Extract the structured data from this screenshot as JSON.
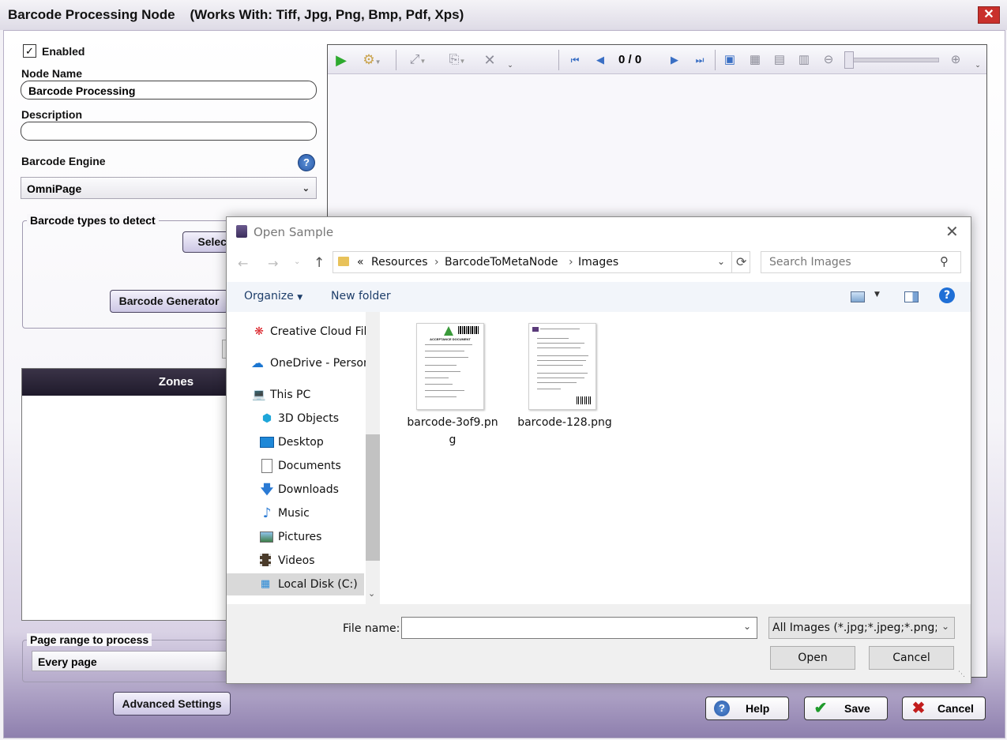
{
  "window": {
    "title": "Barcode Processing Node    (Works With: Tiff, Jpg, Png, Bmp, Pdf, Xps)",
    "close_glyph": "✕"
  },
  "form": {
    "enabled_label": "Enabled",
    "enabled_checked": "✓",
    "node_name_label": "Node Name",
    "node_name_value": "Barcode Processing",
    "description_label": "Description",
    "description_value": "",
    "barcode_engine_label": "Barcode Engine",
    "barcode_engine_value": "OmniPage",
    "barcode_types_label": "Barcode types to detect",
    "select_button": "Select",
    "barcode_generator_button": "Barcode Generator",
    "zones_header": "Zones",
    "page_range_label": "Page range to process",
    "page_range_value": "Every page",
    "advanced_settings_button": "Advanced Settings",
    "help_icon": "?"
  },
  "viewer": {
    "page_current": "0",
    "page_sep": "/",
    "page_total": "0",
    "icons": [
      "play-icon",
      "gear-icon",
      "auto-fit-icon",
      "scanner-icon",
      "delete-icon",
      "first-page-icon",
      "prev-page-icon",
      "next-page-icon",
      "last-page-icon",
      "image-icon",
      "fit-page-icon",
      "fit-width-icon",
      "fit-height-icon",
      "zoom-out-icon",
      "zoom-in-icon"
    ]
  },
  "footer": {
    "help_label": "Help",
    "save_label": "Save",
    "cancel_label": "Cancel"
  },
  "dialog": {
    "title": "Open Sample",
    "breadcrumb": [
      "Resources",
      "BarcodeToMetaNode",
      "Images"
    ],
    "breadcrumb_prefix": "«",
    "search_placeholder": "Search Images",
    "organize_label": "Organize",
    "new_folder_label": "New folder",
    "nav_items": [
      {
        "label": "Creative Cloud Files",
        "icon": "creative-cloud-icon"
      },
      {
        "label": "OneDrive - Personal",
        "icon": "onedrive-icon"
      },
      {
        "label": "This PC",
        "icon": "pc-icon"
      },
      {
        "label": "3D Objects",
        "icon": "cube-icon"
      },
      {
        "label": "Desktop",
        "icon": "desktop-icon"
      },
      {
        "label": "Documents",
        "icon": "documents-icon"
      },
      {
        "label": "Downloads",
        "icon": "downloads-icon"
      },
      {
        "label": "Music",
        "icon": "music-icon"
      },
      {
        "label": "Pictures",
        "icon": "pictures-icon"
      },
      {
        "label": "Videos",
        "icon": "videos-icon"
      },
      {
        "label": "Local Disk (C:)",
        "icon": "disk-icon"
      }
    ],
    "files": [
      {
        "name_line1": "barcode-3of9.pn",
        "name_line2": "g",
        "thumb_title": "ACCEPTANCE DOCUMENT"
      },
      {
        "name_line1": "barcode-128.png",
        "name_line2": ""
      }
    ],
    "file_name_label": "File name:",
    "file_name_value": "",
    "file_type_value": "All Images (*.jpg;*.jpeg;*.png;*.g",
    "open_label": "Open",
    "cancel_label": "Cancel"
  },
  "colors": {
    "accent": "#2b73c9",
    "save_check": "#1f9a2b",
    "cancel_x": "#c21d1d",
    "zones_header_bg": "#2a2436"
  }
}
